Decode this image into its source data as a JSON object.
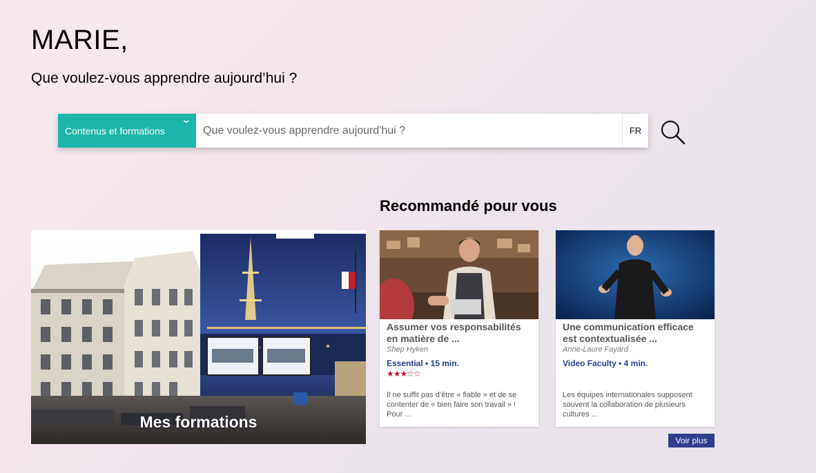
{
  "greeting": "MARIE,",
  "subtitle": "Que voulez-vous apprendre aujourd’hui ?",
  "search": {
    "category": "Contenus et formations",
    "placeholder": "Que voulez-vous apprendre aujourd'hui ?",
    "language": "FR"
  },
  "section_title": "Recommandé pour vous",
  "mes_formations": {
    "label": "Mes formations"
  },
  "cards": [
    {
      "title": "Assumer vos responsabilités en matière de ...",
      "author": "Shep Hyken",
      "meta": "Essential • 15 min.",
      "rating": 3,
      "rating_max": 5,
      "description": "Il ne suffit pas d’être « fiable » et de se contenter de « bien faire son travail » ! Pour ..."
    },
    {
      "title": "Une communication efficace est contextualisée ...",
      "author": "Anne-Laure Fayard",
      "meta": "Video Faculty • 4 min.",
      "description": "Les équipes internationales supposent souvent la collaboration de plusieurs cultures ..."
    }
  ],
  "voir_plus": "Voir plus",
  "colors": {
    "accent_teal": "#1bb5ab",
    "button_blue": "#2f3d8c",
    "star_red": "#b01a2a"
  }
}
